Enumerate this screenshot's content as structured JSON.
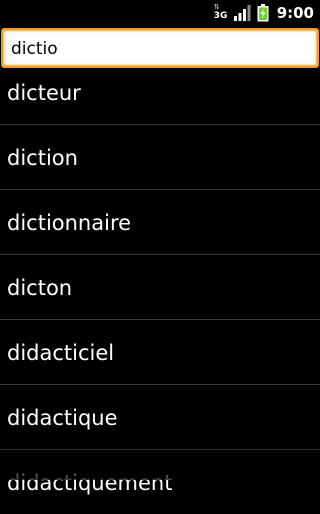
{
  "status_bar": {
    "network_label": "3G",
    "time": "9:00",
    "battery_color": "#6fd12a"
  },
  "search": {
    "value": "dictio"
  },
  "results": [
    "dicteur",
    "diction",
    "dictionnaire",
    "dicton",
    "didacticiel",
    "didactique",
    "didactiquement"
  ]
}
